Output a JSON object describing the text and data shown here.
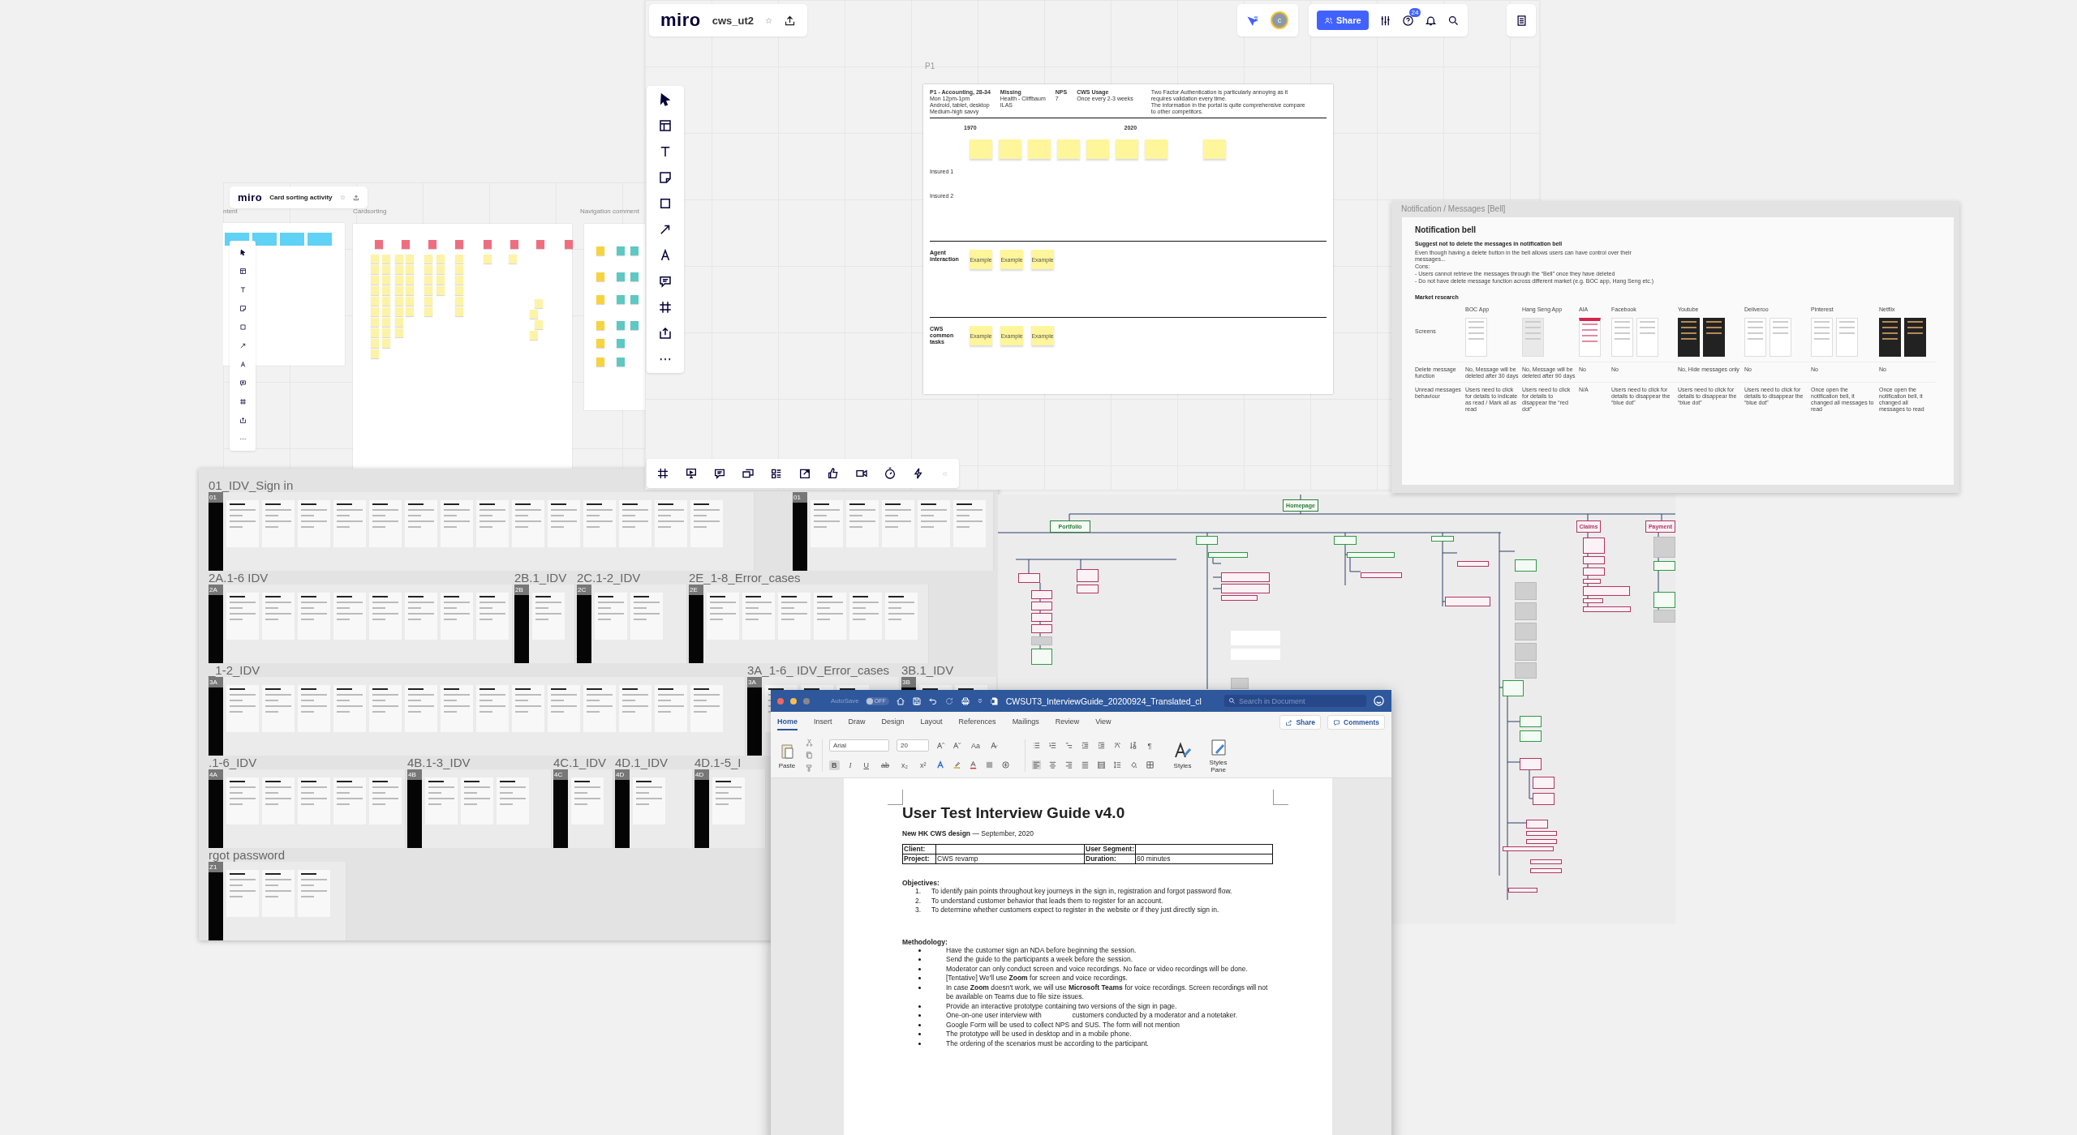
{
  "board_main": {
    "logo": "miro",
    "title": "cws_ut2",
    "avatar": "c",
    "share": "Share",
    "help_badge": "24",
    "frame_label": "P1",
    "frame": {
      "header": [
        {
          "lines": [
            "P1 - Accounting, 28-34",
            "Mon 12pm-1pm",
            "Android, tablet, desktop",
            "Medium-high savvy"
          ]
        },
        {
          "lines": [
            "Missing",
            "Health - Cliffbaum",
            "ILAS"
          ]
        },
        {
          "lines": [
            "NPS",
            "7"
          ]
        },
        {
          "lines": [
            "CWS Usage",
            "Once every 2-3 weeks"
          ]
        },
        {
          "lines": [
            "Two Factor Authentication is particularly annoying as it requires validation every time.",
            "The information in the portal is quite comprehensive compare to other competitors."
          ]
        }
      ],
      "years": [
        "1970",
        "2020"
      ],
      "rows": [
        "Insured 1",
        "Insured 2"
      ],
      "lanes": [
        {
          "label": "Agent interaction",
          "stickies": [
            "Example",
            "Example",
            "Example"
          ]
        },
        {
          "label": "CWS common tasks",
          "stickies": [
            "Example",
            "Example",
            "Example"
          ]
        }
      ]
    }
  },
  "board_cards": {
    "logo": "miro",
    "title": "Card sorting activity",
    "frame_labels": [
      "ntent",
      "Cardsorting",
      "Navigation comment"
    ]
  },
  "idv": {
    "rows": [
      {
        "groups": [
          {
            "label": "01_IDV_Sign in",
            "tag": "01"
          },
          {
            "tag": "01"
          }
        ]
      },
      {
        "groups": [
          {
            "label": "2A.1-6 IDV",
            "tag": "2A"
          },
          {
            "label": "2B.1_IDV",
            "tag": "2B"
          },
          {
            "label": "2C.1-2_IDV",
            "tag": "2C"
          },
          {
            "label": "2E_1-8_Error_cases",
            "tag": "2E"
          }
        ]
      },
      {
        "groups": [
          {
            "label": "_1-2_IDV",
            "tag": "3A"
          },
          {
            "label": "3A_1-6_ IDV_Error_cases",
            "tag": "3A"
          },
          {
            "label": "3B.1_IDV",
            "tag": "3B"
          }
        ]
      },
      {
        "groups": [
          {
            "label": ".1-6_IDV",
            "tag": "4A"
          },
          {
            "label": "4B.1-3_IDV",
            "tag": "4B"
          },
          {
            "label": "4C.1_IDV",
            "tag": "4C"
          },
          {
            "label": "4D.1_IDV",
            "tag": "4D"
          },
          {
            "label": "4D.1-5_I",
            "tag": "4D"
          }
        ]
      },
      {
        "groups": [
          {
            "label": "rgot password",
            "tag": "Z1"
          }
        ]
      }
    ]
  },
  "notification": {
    "frame_label": "Notification / Messages [Bell]",
    "title": "Notification bell",
    "summary": "Suggest not to delete the messages in notification bell",
    "body": [
      "Even though having a delete button in the bell allows users can have control over their messages...",
      "Cons:",
      "- Users cannot retrieve the messages through the “Bell” once they have deleted",
      "- Do not have delete message function across different market (e.g. BOC app, Hang Seng etc.)"
    ],
    "section": "Market research",
    "row_labels": [
      "Screens",
      "Delete message function",
      "Unread messages behaviour"
    ],
    "apps": [
      {
        "name": "BOC App",
        "kind": "light",
        "delete": "No, Message will be deleted after 30 days",
        "unread": "Users need to click for details to indicate as read / Mark all as read"
      },
      {
        "name": "Hang Seng App",
        "kind": "grey",
        "delete": "No, Message will be deleted after 90 days",
        "unread": "Users need to click for details to disappear the “red dot”"
      },
      {
        "name": "AIA",
        "kind": "red",
        "delete": "No",
        "unread": "N/A"
      },
      {
        "name": "Facebook",
        "kind": "light",
        "delete": "No",
        "unread": "Users need to click for details to disappear the “blue dot”"
      },
      {
        "name": "Youtube",
        "kind": "dark",
        "delete": "No, Hide messages only",
        "unread": "Users need to click for details to disappear the “blue dot”"
      },
      {
        "name": "Deliveroo",
        "kind": "light",
        "delete": "No",
        "unread": "Users need to click for details to disappear the “blue dot”"
      },
      {
        "name": "Pinterest",
        "kind": "light",
        "delete": "No",
        "unread": "Once open the notification bell, it changed all messages to read"
      },
      {
        "name": "Netflix",
        "kind": "dark",
        "delete": "No",
        "unread": "Once open the notification bell, it changed all messages to read"
      }
    ]
  },
  "sitemap": {
    "nodes": [
      {
        "label": "Homepage",
        "kind": "green"
      },
      {
        "label": "Portfolio",
        "kind": "green"
      },
      {
        "label": "Claims",
        "kind": "pink"
      },
      {
        "label": "Payment",
        "kind": "pink"
      }
    ]
  },
  "word": {
    "title": "CWSUT3_InterviewGuide_20200924_Translated_cl",
    "autosave": {
      "label": "AutoSave",
      "on": false,
      "state": "OFF"
    },
    "search_placeholder": "Search in Document",
    "tabs": [
      {
        "label": "Home",
        "selected": true
      },
      {
        "label": "Insert",
        "selected": false
      },
      {
        "label": "Draw",
        "selected": false
      },
      {
        "label": "Design",
        "selected": false
      },
      {
        "label": "Layout",
        "selected": false
      },
      {
        "label": "References",
        "selected": false
      },
      {
        "label": "Mailings",
        "selected": false
      },
      {
        "label": "Review",
        "selected": false
      },
      {
        "label": "View",
        "selected": false
      }
    ],
    "share": "Share",
    "comments": "Comments",
    "paste": "Paste",
    "font": "Arial",
    "size": "20",
    "change_case": "Aa",
    "format_keys": [
      {
        "label": "B",
        "kind": "bold",
        "selected": true
      },
      {
        "label": "I",
        "kind": "italic",
        "selected": false
      },
      {
        "label": "U",
        "kind": "underline",
        "selected": false
      },
      {
        "label": "ab",
        "kind": "strike",
        "selected": false
      },
      {
        "label": "x₂",
        "kind": "plain",
        "selected": false
      },
      {
        "label": "x²",
        "kind": "plain",
        "selected": false
      }
    ],
    "pilcrow": "¶",
    "styles": "Styles",
    "styles_pane": "Styles Pane",
    "doc": {
      "title": "User Test Interview Guide v4.0",
      "subtitle": "**New HK CWS design** — September, 2020",
      "table": [
        [
          {
            "label": "Client:"
          },
          {
            "label": "User Segment:"
          }
        ],
        [
          {
            "label": "Project:",
            "value": "CWS revamp"
          },
          {
            "label": "Duration:",
            "value": "60 minutes"
          }
        ]
      ],
      "objectives_heading": "Objectives:",
      "objectives": [
        {
          "num": "1.",
          "text": "To identify pain points throughout key journeys in the sign in, registration and forgot password flow."
        },
        {
          "num": "2.",
          "text": "To understand customer behavior that leads them to register for an account."
        },
        {
          "num": "3.",
          "text": "To determine whether customers expect to register in the website or if they just directly sign in."
        }
      ],
      "methodology_heading": "Methodology:",
      "methodology": [
        "Have the customer sign an NDA before beginning the session.",
        "Send the guide to the participants a week before the session.",
        "Moderator can only conduct screen and voice recordings. No face or video recordings will be done.",
        "[Tentative] We'll use **Zoom** for screen and voice recordings.",
        "In case **Zoom** doesn't work, we will use **Microsoft Teams** for voice recordings. Screen recordings will not be available on Teams due to file size issues.",
        "Provide an interactive prototype containing two versions of the sign in page.",
        "One-on-one user interview with                customers conducted by a moderator and a notetaker.",
        "Google Form will be used to collect NPS and SUS. The form will not mention",
        "The prototype will be used in desktop and in a mobile phone.",
        "The ordering of the scenarios must be according to the participant."
      ]
    }
  }
}
